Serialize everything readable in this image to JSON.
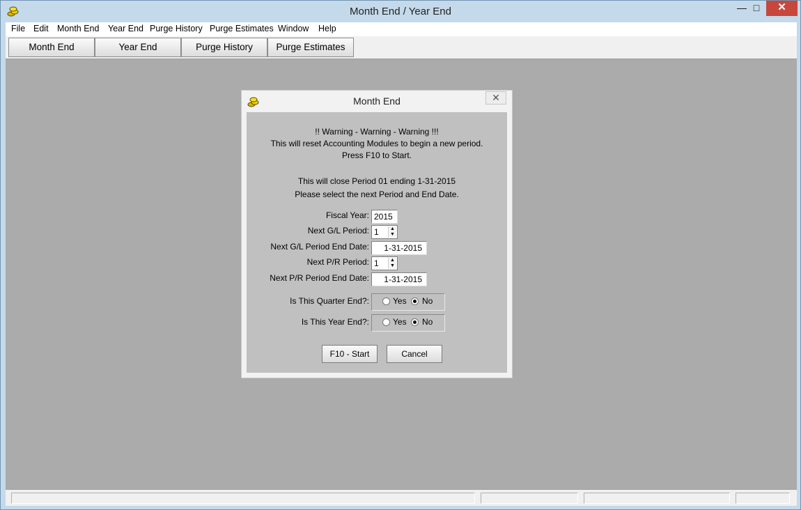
{
  "window": {
    "title": "Month End / Year End",
    "minimize_glyph": "—",
    "maximize_glyph": "□",
    "close_glyph": "✕"
  },
  "menu": [
    "File",
    "Edit",
    "Month End",
    "Year End",
    "Purge History",
    "Purge Estimates",
    "Window",
    "Help"
  ],
  "toolbar": [
    "Month End",
    "Year End",
    "Purge History",
    "Purge Estimates"
  ],
  "dialog": {
    "title": "Month End",
    "close_glyph": "✕",
    "warning_lines": [
      "!! Warning - Warning - Warning !!!",
      "This will reset Accounting Modules to begin a new period.",
      "Press F10 to Start."
    ],
    "close_period_line": "This will close Period  01 ending  1-31-2015",
    "select_line": "Please select the next Period and End Date.",
    "fiscal_year": {
      "label": "Fiscal Year:",
      "value": "2015"
    },
    "next_gl_period": {
      "label": "Next G/L Period:",
      "value": "1"
    },
    "next_gl_end_date": {
      "label": "Next G/L Period End Date:",
      "value": "1-31-2015"
    },
    "next_pr_period": {
      "label": "Next P/R Period:",
      "value": "1"
    },
    "next_pr_end_date": {
      "label": "Next P/R Period End Date:",
      "value": "1-31-2015"
    },
    "quarter_end": {
      "label": "Is This Quarter End?:",
      "yes": "Yes",
      "no": "No",
      "selected": "No"
    },
    "year_end": {
      "label": "Is This Year End?:",
      "yes": "Yes",
      "no": "No",
      "selected": "No"
    },
    "start_button": "F10 - Start",
    "cancel_button": "Cancel"
  },
  "colors": {
    "titlebar": "#c4d9ea",
    "close_button": "#c7473c",
    "workspace": "#ababab",
    "dialog_body": "#c0c0c0"
  }
}
